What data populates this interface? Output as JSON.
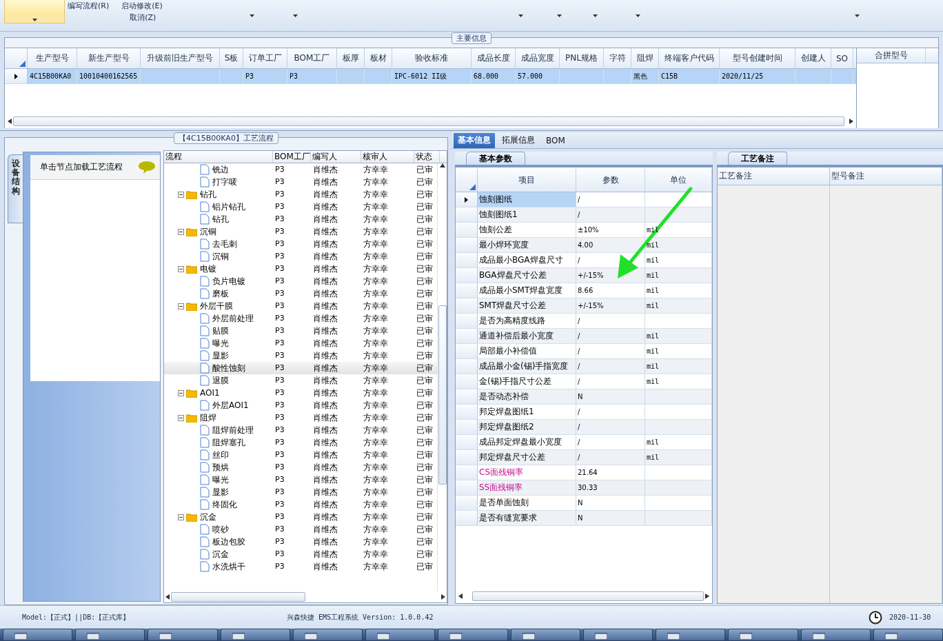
{
  "ribbon": {
    "commands": [
      {
        "label": "编写流程(R)"
      },
      {
        "label": "启动修改(E)"
      },
      {
        "label": "取消(Z)"
      }
    ]
  },
  "main_info": {
    "title": "主要信息",
    "columns": [
      "生产型号",
      "新生产型号",
      "升级前旧生产型号",
      "S板",
      "订单工厂",
      "BOM工厂",
      "板厚",
      "板材",
      "验收标准",
      "成品长度",
      "成品宽度",
      "PNL规格",
      "字符",
      "阻焊",
      "终端客户代码",
      "型号创建时间",
      "创建人",
      "SO"
    ],
    "rows": [
      {
        "selected": true,
        "cells": [
          "4C15B00KA0",
          "10010400162565",
          "",
          "",
          "P3",
          "P3",
          "",
          "",
          "IPC-6012 II级",
          "68.000",
          "57.000",
          "",
          "",
          "黑色",
          "C15B",
          "2020/11/25",
          "",
          ""
        ]
      }
    ],
    "side_columns": [
      "合拼型号"
    ]
  },
  "side_nav": {
    "tab": "设备结构",
    "hint": "单击节点加载工艺流程"
  },
  "flow": {
    "title": "【4C15B00KA0】工艺流程",
    "columns": [
      "流程",
      "BOM工厂",
      "编写人",
      "核审人",
      "状态"
    ],
    "tree": [
      {
        "kind": "file",
        "name": "铣边",
        "factory": "P3",
        "writer": "肖维杰",
        "reviewer": "方幸幸",
        "status": "已审",
        "selected": false
      },
      {
        "kind": "file",
        "name": "打字唛",
        "factory": "P3",
        "writer": "肖维杰",
        "reviewer": "方幸幸",
        "status": "已审",
        "selected": false
      },
      {
        "kind": "folder",
        "name": "钻孔",
        "factory": "P3",
        "writer": "肖维杰",
        "reviewer": "方幸幸",
        "status": "已审",
        "selected": false,
        "expanded": true,
        "children": [
          {
            "kind": "file",
            "name": "铝片钻孔",
            "factory": "P3",
            "writer": "肖维杰",
            "reviewer": "方幸幸",
            "status": "已审",
            "selected": false
          },
          {
            "kind": "file",
            "name": "钻孔",
            "factory": "P3",
            "writer": "肖维杰",
            "reviewer": "方幸幸",
            "status": "已审",
            "selected": false
          }
        ]
      },
      {
        "kind": "folder",
        "name": "沉铜",
        "factory": "P3",
        "writer": "肖维杰",
        "reviewer": "方幸幸",
        "status": "已审",
        "selected": false,
        "expanded": true,
        "children": [
          {
            "kind": "file",
            "name": "去毛刺",
            "factory": "P3",
            "writer": "肖维杰",
            "reviewer": "方幸幸",
            "status": "已审",
            "selected": false
          },
          {
            "kind": "file",
            "name": "沉铜",
            "factory": "P3",
            "writer": "肖维杰",
            "reviewer": "方幸幸",
            "status": "已审",
            "selected": false
          }
        ]
      },
      {
        "kind": "folder",
        "name": "电镀",
        "factory": "P3",
        "writer": "肖维杰",
        "reviewer": "方幸幸",
        "status": "已审",
        "selected": false,
        "expanded": true,
        "children": [
          {
            "kind": "file",
            "name": "负片电镀",
            "factory": "P3",
            "writer": "肖维杰",
            "reviewer": "方幸幸",
            "status": "已审",
            "selected": false
          },
          {
            "kind": "file",
            "name": "磨板",
            "factory": "P3",
            "writer": "肖维杰",
            "reviewer": "方幸幸",
            "status": "已审",
            "selected": false
          }
        ]
      },
      {
        "kind": "folder",
        "name": "外层干膜",
        "factory": "P3",
        "writer": "肖维杰",
        "reviewer": "方幸幸",
        "status": "已审",
        "selected": false,
        "expanded": true,
        "children": [
          {
            "kind": "file",
            "name": "外层前处理",
            "factory": "P3",
            "writer": "肖维杰",
            "reviewer": "方幸幸",
            "status": "已审",
            "selected": false
          },
          {
            "kind": "file",
            "name": "贴膜",
            "factory": "P3",
            "writer": "肖维杰",
            "reviewer": "方幸幸",
            "status": "已审",
            "selected": false
          },
          {
            "kind": "file",
            "name": "曝光",
            "factory": "P3",
            "writer": "肖维杰",
            "reviewer": "方幸幸",
            "status": "已审",
            "selected": false
          },
          {
            "kind": "file",
            "name": "显影",
            "factory": "P3",
            "writer": "肖维杰",
            "reviewer": "方幸幸",
            "status": "已审",
            "selected": false
          },
          {
            "kind": "file",
            "name": "酸性蚀刻",
            "factory": "P3",
            "writer": "肖维杰",
            "reviewer": "方幸幸",
            "status": "已审",
            "selected": true
          },
          {
            "kind": "file",
            "name": "退膜",
            "factory": "P3",
            "writer": "肖维杰",
            "reviewer": "方幸幸",
            "status": "已审",
            "selected": false
          }
        ]
      },
      {
        "kind": "folder",
        "name": "AOI1",
        "factory": "P3",
        "writer": "肖维杰",
        "reviewer": "方幸幸",
        "status": "已审",
        "selected": false,
        "expanded": true,
        "children": [
          {
            "kind": "file",
            "name": "外层AOI1",
            "factory": "P3",
            "writer": "肖维杰",
            "reviewer": "方幸幸",
            "status": "已审",
            "selected": false
          }
        ]
      },
      {
        "kind": "folder",
        "name": "阻焊",
        "factory": "P3",
        "writer": "肖维杰",
        "reviewer": "方幸幸",
        "status": "已审",
        "selected": false,
        "expanded": true,
        "children": [
          {
            "kind": "file",
            "name": "阻焊前处理",
            "factory": "P3",
            "writer": "肖维杰",
            "reviewer": "方幸幸",
            "status": "已审",
            "selected": false
          },
          {
            "kind": "file",
            "name": "阻焊塞孔",
            "factory": "P3",
            "writer": "肖维杰",
            "reviewer": "方幸幸",
            "status": "已审",
            "selected": false
          },
          {
            "kind": "file",
            "name": "丝印",
            "factory": "P3",
            "writer": "肖维杰",
            "reviewer": "方幸幸",
            "status": "已审",
            "selected": false
          },
          {
            "kind": "file",
            "name": "预烘",
            "factory": "P3",
            "writer": "肖维杰",
            "reviewer": "方幸幸",
            "status": "已审",
            "selected": false
          },
          {
            "kind": "file",
            "name": "曝光",
            "factory": "P3",
            "writer": "肖维杰",
            "reviewer": "方幸幸",
            "status": "已审",
            "selected": false
          },
          {
            "kind": "file",
            "name": "显影",
            "factory": "P3",
            "writer": "肖维杰",
            "reviewer": "方幸幸",
            "status": "已审",
            "selected": false
          },
          {
            "kind": "file",
            "name": "终固化",
            "factory": "P3",
            "writer": "肖维杰",
            "reviewer": "方幸幸",
            "status": "已审",
            "selected": false
          }
        ]
      },
      {
        "kind": "folder",
        "name": "沉金",
        "factory": "P3",
        "writer": "肖维杰",
        "reviewer": "方幸幸",
        "status": "已审",
        "selected": false,
        "expanded": true,
        "children": [
          {
            "kind": "file",
            "name": "喷砂",
            "factory": "P3",
            "writer": "肖维杰",
            "reviewer": "方幸幸",
            "status": "已审",
            "selected": false
          },
          {
            "kind": "file",
            "name": "板边包胶",
            "factory": "P3",
            "writer": "肖维杰",
            "reviewer": "方幸幸",
            "status": "已审",
            "selected": false
          },
          {
            "kind": "file",
            "name": "沉金",
            "factory": "P3",
            "writer": "肖维杰",
            "reviewer": "方幸幸",
            "status": "已审",
            "selected": false
          },
          {
            "kind": "file",
            "name": "水洗烘干",
            "factory": "P3",
            "writer": "肖维杰",
            "reviewer": "方幸幸",
            "status": "已审",
            "selected": false
          }
        ]
      }
    ]
  },
  "detail_tabs": [
    {
      "label": "基本信息",
      "selected": true
    },
    {
      "label": "拓展信息",
      "selected": false
    },
    {
      "label": "BOM",
      "selected": false
    }
  ],
  "params": {
    "tab": "基本参数",
    "columns": [
      "项目",
      "参数",
      "单位"
    ],
    "rows": [
      {
        "item": "蚀刻图纸",
        "value": "/",
        "unit": "",
        "selected": true
      },
      {
        "item": "蚀刻图纸1",
        "value": "/",
        "unit": "",
        "selected": false
      },
      {
        "item": "蚀刻公差",
        "value": "±10%",
        "unit": "mil",
        "selected": false
      },
      {
        "item": "最小焊环宽度",
        "value": "4.00",
        "unit": "mil",
        "selected": false
      },
      {
        "item": "成品最小BGA焊盘尺寸",
        "value": "/",
        "unit": "mil",
        "selected": false
      },
      {
        "item": "BGA焊盘尺寸公差",
        "value": "+/-15%",
        "unit": "mil",
        "selected": false
      },
      {
        "item": "成品最小SMT焊盘宽度",
        "value": "8.66",
        "unit": "mil",
        "selected": false
      },
      {
        "item": "SMT焊盘尺寸公差",
        "value": "+/-15%",
        "unit": "mil",
        "selected": false
      },
      {
        "item": "是否为高精度线路",
        "value": "/",
        "unit": "",
        "selected": false
      },
      {
        "item": "通道补偿后最小宽度",
        "value": "/",
        "unit": "mil",
        "selected": false
      },
      {
        "item": "局部最小补偿值",
        "value": "/",
        "unit": "mil",
        "selected": false
      },
      {
        "item": "成品最小金(锡)手指宽度",
        "value": "/",
        "unit": "mil",
        "selected": false
      },
      {
        "item": "金(锡)手指尺寸公差",
        "value": "/",
        "unit": "mil",
        "selected": false
      },
      {
        "item": "是否动态补偿",
        "value": "N",
        "unit": "",
        "selected": false
      },
      {
        "item": "邦定焊盘图纸1",
        "value": "/",
        "unit": "",
        "selected": false
      },
      {
        "item": "邦定焊盘图纸2",
        "value": "/",
        "unit": "",
        "selected": false
      },
      {
        "item": "成品邦定焊盘最小宽度",
        "value": "/",
        "unit": "mil",
        "selected": false
      },
      {
        "item": "邦定焊盘尺寸公差",
        "value": "/",
        "unit": "mil",
        "selected": false
      },
      {
        "item": "CS面残铜率",
        "value": "21.64",
        "unit": "",
        "selected": false,
        "color": "#c0108c"
      },
      {
        "item": "SS面残铜率",
        "value": "30.33",
        "unit": "",
        "selected": false,
        "color": "#c0108c"
      },
      {
        "item": "是否单面蚀刻",
        "value": "N",
        "unit": "",
        "selected": false
      },
      {
        "item": "是否有缝宽要求",
        "value": "N",
        "unit": "",
        "selected": false
      }
    ]
  },
  "remarks": {
    "tab": "工艺备注",
    "columns": [
      "工艺备注",
      "型号备注"
    ]
  },
  "status_bar": {
    "mode": "Model:【正式】||DB:【正式库】",
    "app": "兴森快捷 EMS工程系统 Version: 1.0.0.42",
    "date": "2020-11-30"
  }
}
